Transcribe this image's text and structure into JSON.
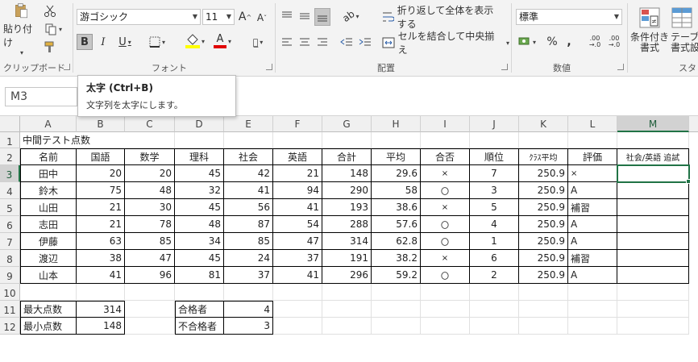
{
  "ribbon": {
    "clipboard": {
      "paste_label": "貼り付け",
      "group_label": "クリップボード"
    },
    "font": {
      "font_name": "游ゴシック",
      "font_size": "11",
      "bold": "B",
      "italic": "I",
      "underline": "U",
      "increase": "A",
      "decrease": "A",
      "font_color_letter": "A",
      "group_label": "フォント"
    },
    "alignment": {
      "wrap_label": "折り返して全体を表示する",
      "merge_label": "セルを結合して中央揃え",
      "group_label": "配置"
    },
    "number": {
      "format": "標準",
      "percent": "%",
      "comma": ",",
      "inc_decimal": ".00\n→.0",
      "dec_decimal": ".00\n→.0",
      "group_label": "数値"
    },
    "styles": {
      "conditional_label": "条件付き\n書式",
      "table_label": "テーブル\n書式設",
      "group_label": "スタ"
    }
  },
  "tooltip": {
    "title": "太字 (Ctrl+B)",
    "desc": "文字列を太字にします。"
  },
  "name_box": "M3",
  "columns": [
    "A",
    "B",
    "C",
    "D",
    "E",
    "F",
    "G",
    "H",
    "I",
    "J",
    "K",
    "L",
    "M"
  ],
  "rows": [
    "1",
    "2",
    "3",
    "4",
    "5",
    "6",
    "7",
    "8",
    "9",
    "10",
    "11",
    "12"
  ],
  "sheet": {
    "title": "中間テスト点数",
    "headers": [
      "名前",
      "国語",
      "数学",
      "理科",
      "社会",
      "英語",
      "合計",
      "平均",
      "合否",
      "順位",
      "ｸﾗｽ平均",
      "評価",
      "社会/英語 追試"
    ],
    "students": [
      [
        "田中",
        "20",
        "20",
        "45",
        "42",
        "21",
        "148",
        "29.6",
        "×",
        "7",
        "250.9",
        "×",
        ""
      ],
      [
        "鈴木",
        "75",
        "48",
        "32",
        "41",
        "94",
        "290",
        "58",
        "〇",
        "3",
        "250.9",
        "A",
        ""
      ],
      [
        "山田",
        "21",
        "30",
        "45",
        "56",
        "41",
        "193",
        "38.6",
        "×",
        "5",
        "250.9",
        "補習",
        ""
      ],
      [
        "志田",
        "21",
        "78",
        "48",
        "87",
        "54",
        "288",
        "57.6",
        "〇",
        "4",
        "250.9",
        "A",
        ""
      ],
      [
        "伊藤",
        "63",
        "85",
        "34",
        "85",
        "47",
        "314",
        "62.8",
        "〇",
        "1",
        "250.9",
        "A",
        ""
      ],
      [
        "渡辺",
        "38",
        "47",
        "45",
        "24",
        "37",
        "191",
        "38.2",
        "×",
        "6",
        "250.9",
        "補習",
        ""
      ],
      [
        "山本",
        "41",
        "96",
        "81",
        "37",
        "41",
        "296",
        "59.2",
        "〇",
        "2",
        "250.9",
        "A",
        ""
      ]
    ],
    "summary": [
      {
        "label": "最大点数",
        "value": "314"
      },
      {
        "label": "最小点数",
        "value": "148"
      }
    ],
    "pass": [
      {
        "label": "合格者",
        "value": "4"
      },
      {
        "label": "不合格者",
        "value": "3"
      }
    ]
  }
}
